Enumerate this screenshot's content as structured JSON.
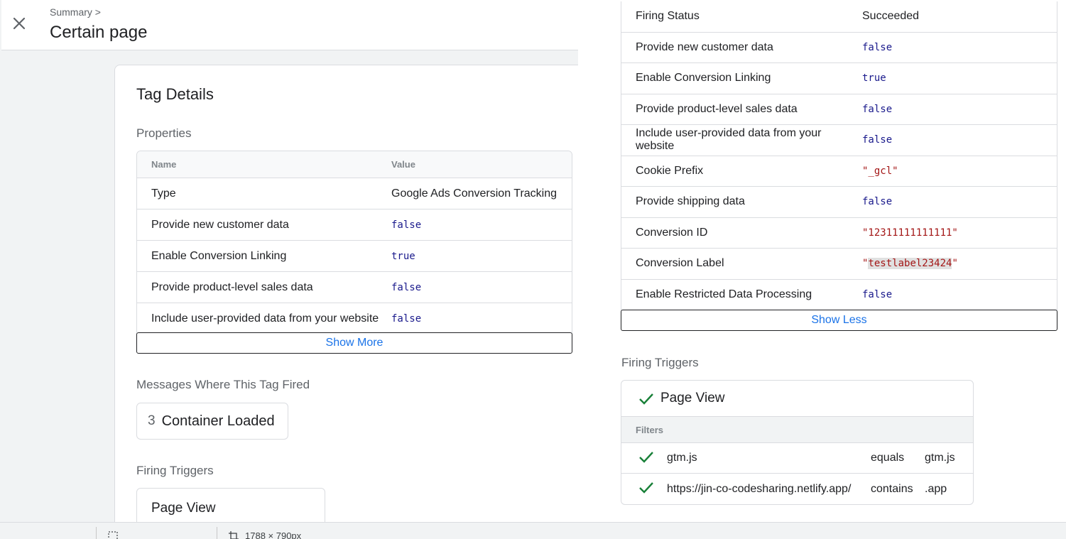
{
  "header": {
    "breadcrumb": "Summary >",
    "title": "Certain page",
    "close_icon": "close-icon"
  },
  "tag_details": {
    "title": "Tag Details",
    "properties_title": "Properties",
    "columns": [
      "Name",
      "Value"
    ],
    "rows": [
      {
        "name": "Type",
        "value": "Google Ads Conversion Tracking"
      },
      {
        "name": "Provide new customer data",
        "value": "false"
      },
      {
        "name": "Enable Conversion Linking",
        "value": "true"
      },
      {
        "name": "Provide product-level sales data",
        "value": "false"
      },
      {
        "name": "Include user-provided data from your website",
        "value": "false"
      }
    ],
    "show_more": "Show More",
    "messages_title": "Messages Where This Tag Fired",
    "message_chip": {
      "number": "3",
      "label": "Container Loaded"
    },
    "firing_triggers_title": "Firing Triggers",
    "trigger_label": "Page View"
  },
  "expanded_properties": {
    "rows": [
      {
        "name": "Firing Status",
        "value": "Succeeded"
      },
      {
        "name": "Provide new customer data",
        "value": "false"
      },
      {
        "name": "Enable Conversion Linking",
        "value": "true"
      },
      {
        "name": "Provide product-level sales data",
        "value": "false"
      },
      {
        "name": "Include user-provided data from your website",
        "value": "false"
      },
      {
        "name": "Cookie Prefix",
        "value": "\"_gcl\""
      },
      {
        "name": "Provide shipping data",
        "value": "false"
      },
      {
        "name": "Conversion ID",
        "value": "\"12311111111111\""
      },
      {
        "name": "Conversion Label",
        "value_quote_open": "\"",
        "value_highlight": "testlabel23424",
        "value_quote_close": "\""
      },
      {
        "name": "Enable Restricted Data Processing",
        "value": "false"
      }
    ],
    "show_less": "Show Less"
  },
  "firing_triggers": {
    "title": "Firing Triggers",
    "trigger_name": "Page View",
    "filters_label": "Filters",
    "filters": [
      {
        "variable": "gtm.js",
        "operator": "equals",
        "value": "gtm.js"
      },
      {
        "variable": "https://jin-co-codesharing.netlify.app/",
        "operator": "contains",
        "value": ".app"
      }
    ],
    "check_color": "#188038"
  },
  "status_bar": {
    "dimensions": "1788 × 790px"
  },
  "colors": {
    "link": "#1a73e8",
    "keyword": "#1a1a8c",
    "string": "#a31515",
    "highlight": "#e0e0e0"
  }
}
